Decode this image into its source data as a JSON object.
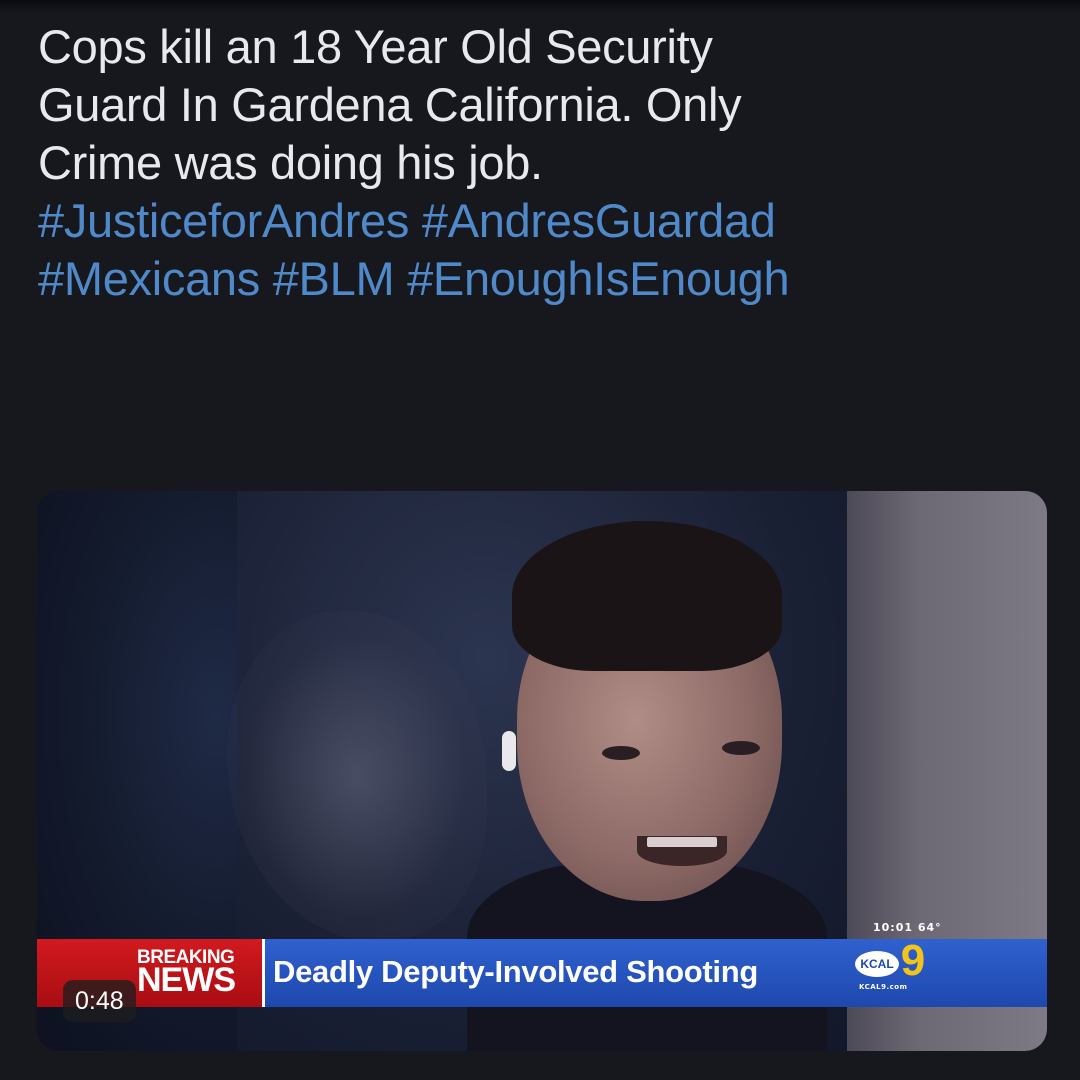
{
  "tweet": {
    "text_lines": [
      "Cops kill an 18 Year Old Security",
      "Guard In Gardena California. Only",
      "Crime was doing his job."
    ],
    "hashtags_line1": [
      "#JusticeforAndres",
      "#AndresGuardad"
    ],
    "hashtags_line2": [
      "#Mexicans",
      "#BLM",
      "#EnoughIsEnough"
    ]
  },
  "video": {
    "duration": "0:48",
    "chyron": {
      "breaking": "BREAKING",
      "news": "NEWS",
      "headline": "Deadly Deputy-Involved Shooting",
      "time_temp": "10:01  64°",
      "station": "KCAL",
      "channel_number": "9",
      "station_url": "KCAL9.com"
    }
  },
  "colors": {
    "background": "#16181d",
    "text": "#e8e9ec",
    "hashtag": "#4f89c9",
    "breaking_red": "#c8161b",
    "headline_blue": "#2a58c2",
    "channel_yellow": "#f2c318"
  }
}
